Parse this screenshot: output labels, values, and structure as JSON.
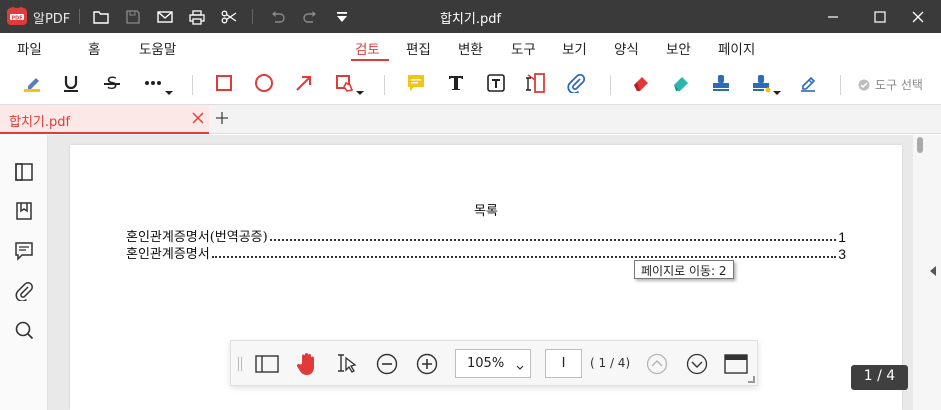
{
  "titlebar": {
    "app_name": "알PDF",
    "document_title": "합치기.pdf"
  },
  "menu": {
    "items": [
      "파일",
      "홈",
      "도움말",
      "검토",
      "편집",
      "변환",
      "도구",
      "보기",
      "양식",
      "보안",
      "페이지"
    ],
    "active": "검토"
  },
  "toolbar": {
    "tool_select_label": "도구 선택"
  },
  "tab": {
    "label": "합치기.pdf"
  },
  "document": {
    "toc_title": "목록",
    "toc_entries": [
      {
        "title": "혼인관계증명서(번역공증)",
        "page": "1"
      },
      {
        "title": "혼인관계증명서",
        "page": "3"
      }
    ],
    "tooltip": "페이지로 이동: 2"
  },
  "navbar": {
    "zoom": "105%",
    "page_input": "I",
    "page_count": "( 1 / 4)"
  },
  "page_indicator": "1 / 4",
  "colors": {
    "accent": "#e03a3a",
    "titlebar": "#3a3a3a",
    "highlight_yellow": "#f2c318",
    "annotation_blue": "#2a6cb8",
    "eraser_teal": "#2bb5b0"
  }
}
